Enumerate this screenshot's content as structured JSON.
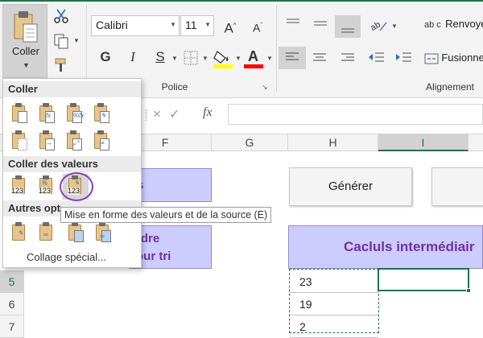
{
  "ribbon": {
    "paste_label": "Coller",
    "font_name": "Calibri",
    "font_size": "11",
    "grow_font": "A",
    "shrink_font": "A",
    "bold": "G",
    "italic": "I",
    "underline": "S",
    "group_police": "Police",
    "group_alignement": "Alignement",
    "wrap_text_label": "Renvoyer",
    "merge_label": "Fusionner",
    "wrap_text_prefix": "ab c",
    "highlight_color": "#ffff00",
    "font_color": "#ff0000",
    "accent": "#217346"
  },
  "formula_bar": {
    "cancel": "×",
    "enter": "✓",
    "fx": "fx"
  },
  "grid": {
    "columns": [
      "F",
      "G",
      "H",
      "I"
    ],
    "active_column": "I",
    "rows": [
      "5",
      "6",
      "7"
    ],
    "active_row": "5",
    "buttons": [
      "Générer"
    ],
    "left_header_fragment": "s",
    "sort_header_fragment_1": "rdre",
    "sort_header_fragment_2": "our tri",
    "intermediate_header": "Cacluls intermédiair",
    "values": [
      "23",
      "19",
      "2"
    ]
  },
  "paste_menu": {
    "section_paste": "Coller",
    "section_values": "Coller des valeurs",
    "section_other": "Autres opt",
    "special": "Collage spécial...",
    "tooltip": "Mise en forme des valeurs et de la source (E)",
    "value_icons": [
      "123",
      "123",
      "123"
    ]
  }
}
